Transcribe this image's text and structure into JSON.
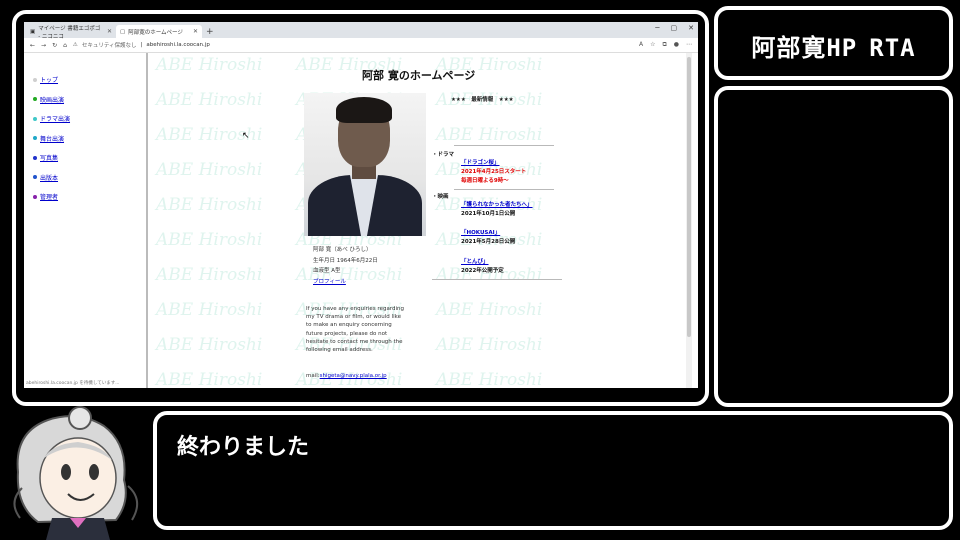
{
  "browser": {
    "tabs": [
      {
        "label": "マイページ 書籍エゴポゴ - ニコニコ",
        "active": false
      },
      {
        "label": "阿部寛のホームページ",
        "active": true
      }
    ],
    "new_tab": "+",
    "address": {
      "security_text": "セキュリティ保護なし",
      "url": "abehiroshi.la.coocan.jp"
    },
    "status_url": "abehiroshi.la.coocan.jp を待機しています..."
  },
  "page": {
    "nav": [
      {
        "label": "トップ",
        "color": "#cfcfcf"
      },
      {
        "label": "映画出演",
        "color": "#22aa22"
      },
      {
        "label": "ドラマ出演",
        "color": "#40c8c8"
      },
      {
        "label": "舞台出演",
        "color": "#20a8c8"
      },
      {
        "label": "写真集",
        "color": "#2233cc"
      },
      {
        "label": "出版本",
        "color": "#2255cc"
      },
      {
        "label": "管理者",
        "color": "#8822aa"
      }
    ],
    "watermark": "ABE Hiroshi",
    "title": "阿部 寛のホームページ",
    "profile": {
      "name": "阿部 寛（あべ ひろし）",
      "birth": "生年月日 1964年6月22日",
      "blood": "血液型 A型",
      "profile_link": "プロフィール"
    },
    "enquiry": "If you have any enquiries regarding my TV drama or film, or would like to make an enquiry concerning future projects, please do not hesitate to contact me through the following email address.",
    "mail_label": "mail:",
    "mail_address": "shigeta@navy.plala.or.jp",
    "news_header": "★★★　最新情報　★★★",
    "drama_section": "・ドラマ",
    "drama": {
      "title": "「ドラゴン桜」",
      "line1": "2021年4月25日スタート",
      "line2": "毎週日曜よる9時～"
    },
    "movie_section": "・映画",
    "movies": [
      {
        "title": "「護られなかった者たちへ」",
        "date": "2021年10月1日公開"
      },
      {
        "title": "「HOKUSAI」",
        "date": "2021年5月28日公開"
      },
      {
        "title": "「とんび」",
        "date": "2022年公開予定"
      }
    ]
  },
  "overlay": {
    "title_left": "阿部寛HP",
    "title_right": "RTA",
    "dialog": "終わりました"
  },
  "colors": {
    "accent_red": "#e00000",
    "link": "#0000cc",
    "watermark": "#dff4ee"
  }
}
